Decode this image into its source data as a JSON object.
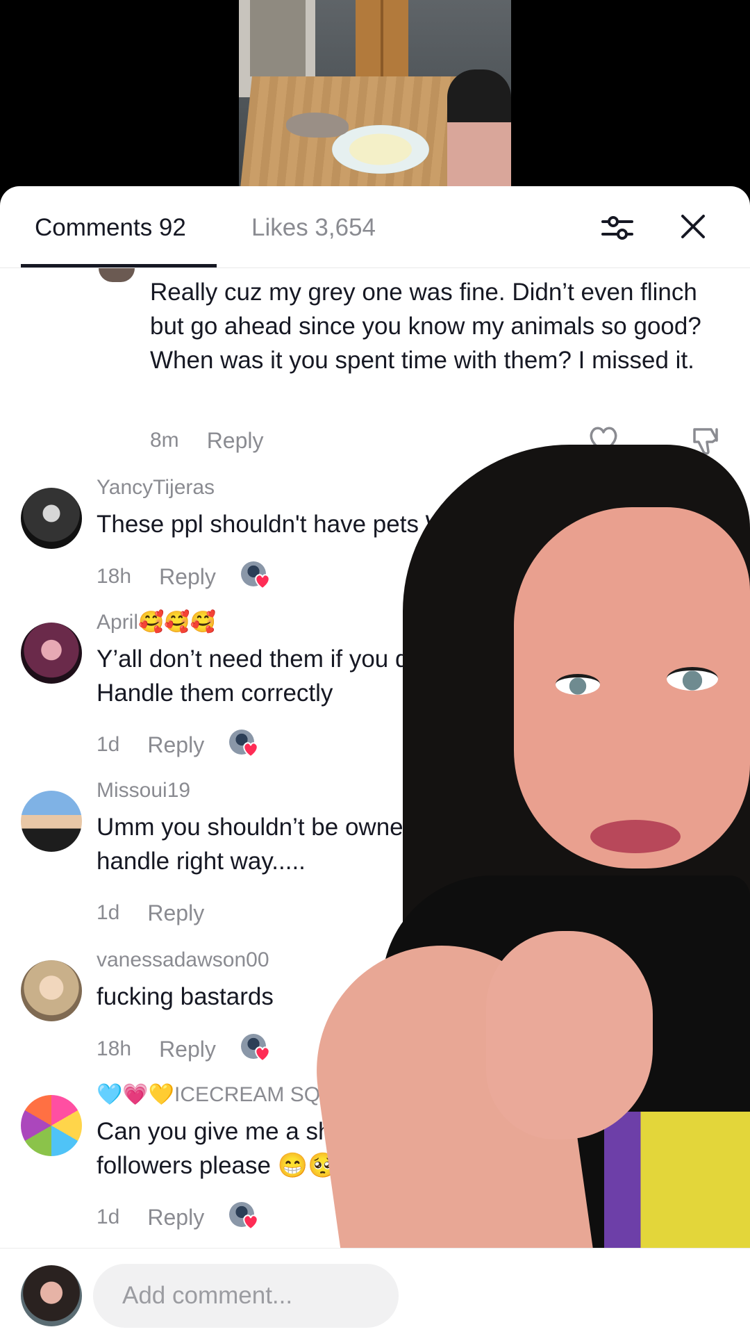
{
  "tabs": {
    "comments_label": "Comments 92",
    "likes_label": "Likes 3,654"
  },
  "reply": {
    "text": "Really cuz my grey one was fine. Didn’t even flinch but go ahead since you know my animals so good? When was it you spent time with them? I missed it.",
    "time": "8m",
    "reply_label": "Reply"
  },
  "comments": [
    {
      "username": "YancyTijeras",
      "text": "These ppl shouldn't have pets WTF??",
      "time": "18h",
      "reply_label": "Reply",
      "creator_liked": true
    },
    {
      "username": "April🥰🥰🥰",
      "text": "Y’all don’t need them if you don’t Handle them correctly",
      "time": "1d",
      "reply_label": "Reply",
      "creator_liked": true
    },
    {
      "username": "Missoui19",
      "text": "Umm you shouldn’t be owner of handle right way.....",
      "time": "1d",
      "reply_label": "Reply",
      "creator_liked": false
    },
    {
      "username": "vanessadawson00",
      "text": "fucking bastards",
      "time": "18h",
      "reply_label": "Reply",
      "creator_liked": true
    },
    {
      "username": "🩵💗💛ICECREAM SQUAD",
      "text": "Can you give me a shou followers please 😁🥺",
      "time": "1d",
      "reply_label": "Reply",
      "creator_liked": true
    }
  ],
  "bottom": {
    "placeholder": "Add comment..."
  },
  "colors": {
    "text_primary": "#161823",
    "text_secondary": "#8a8b91",
    "heart_red": "#fe2c55"
  }
}
